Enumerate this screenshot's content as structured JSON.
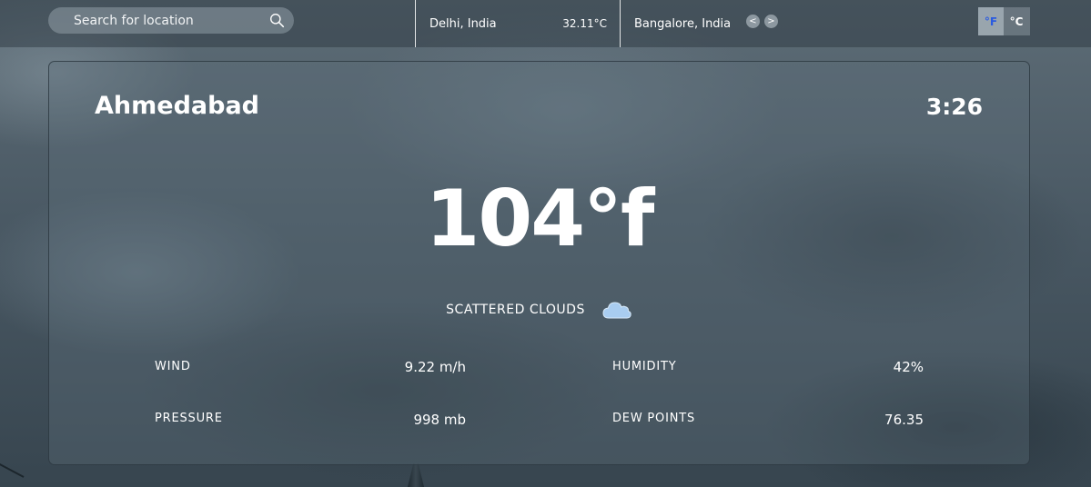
{
  "search": {
    "placeholder": "Search for location"
  },
  "saved_cities": [
    {
      "name": "Delhi, India",
      "temp": "32.11°C"
    },
    {
      "name": "Bangalore, India"
    }
  ],
  "nav": {
    "prev": "<",
    "next": ">"
  },
  "units": {
    "fahrenheit": "°F",
    "celsius": "°C",
    "active": "fahrenheit"
  },
  "weather": {
    "city": "Ahmedabad",
    "time": "3:26",
    "temperature": "104°f",
    "condition": "SCATTERED CLOUDS",
    "stats": [
      {
        "label": "WIND",
        "value": "9.22 m/h"
      },
      {
        "label": "HUMIDITY",
        "value": "42%"
      },
      {
        "label": "PRESSURE",
        "value": "998 mb"
      },
      {
        "label": "DEW POINTS",
        "value": "76.35"
      }
    ]
  },
  "icons": {
    "search": "search-icon",
    "weather": "cloud-icon"
  },
  "colors": {
    "active_unit": "#2a5be0",
    "cloud": "#a9cdf0"
  }
}
